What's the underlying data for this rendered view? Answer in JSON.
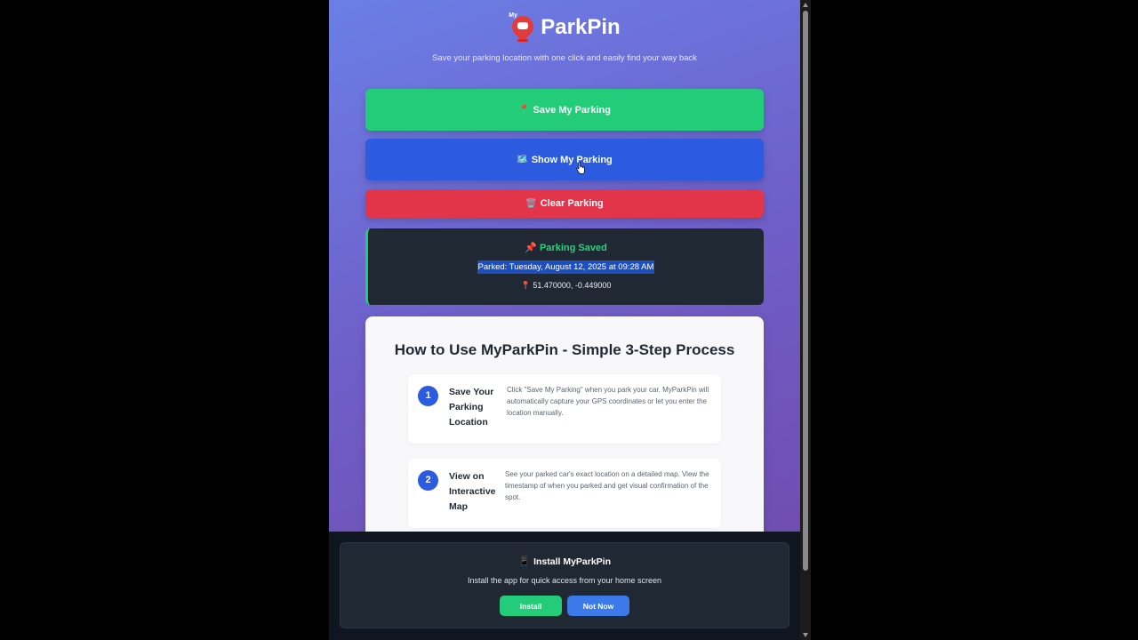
{
  "app": {
    "name": "ParkPin",
    "logo_text": "My",
    "subtitle": "Save your parking location with one click and easily find your way back"
  },
  "actions": {
    "save": {
      "icon": "📍",
      "label": "Save My Parking"
    },
    "show": {
      "icon": "🗺️",
      "label": "Show My Parking"
    },
    "clear": {
      "icon": "🗑️",
      "label": "Clear Parking"
    }
  },
  "status": {
    "icon": "📌",
    "title": "Parking Saved",
    "time": "Parked: Tuesday, August 12, 2025 at 09:28 AM",
    "coords_icon": "📍",
    "coords": "51.470000, -0.449000"
  },
  "howto": {
    "title": "How to Use MyParkPin - Simple 3-Step Process",
    "steps": [
      {
        "num": "1",
        "name": "Save Your Parking Location",
        "desc": "Click \"Save My Parking\" when you park your car. MyParkPin will automatically capture your GPS coordinates or let you enter the location manually."
      },
      {
        "num": "2",
        "name": "View on Interactive Map",
        "desc": "See your parked car's exact location on a detailed map. View the timestamp of when you parked and get visual confirmation of the spot."
      }
    ]
  },
  "install_prompt": {
    "icon": "📱",
    "title": "Install MyParkPin",
    "text": "Install the app for quick access from your home screen",
    "install_label": "Install",
    "dismiss_label": "Not Now"
  },
  "colors": {
    "save": "#22cc78",
    "show": "#2d5be0",
    "clear": "#e3354a",
    "card_dark": "#1f2833"
  }
}
